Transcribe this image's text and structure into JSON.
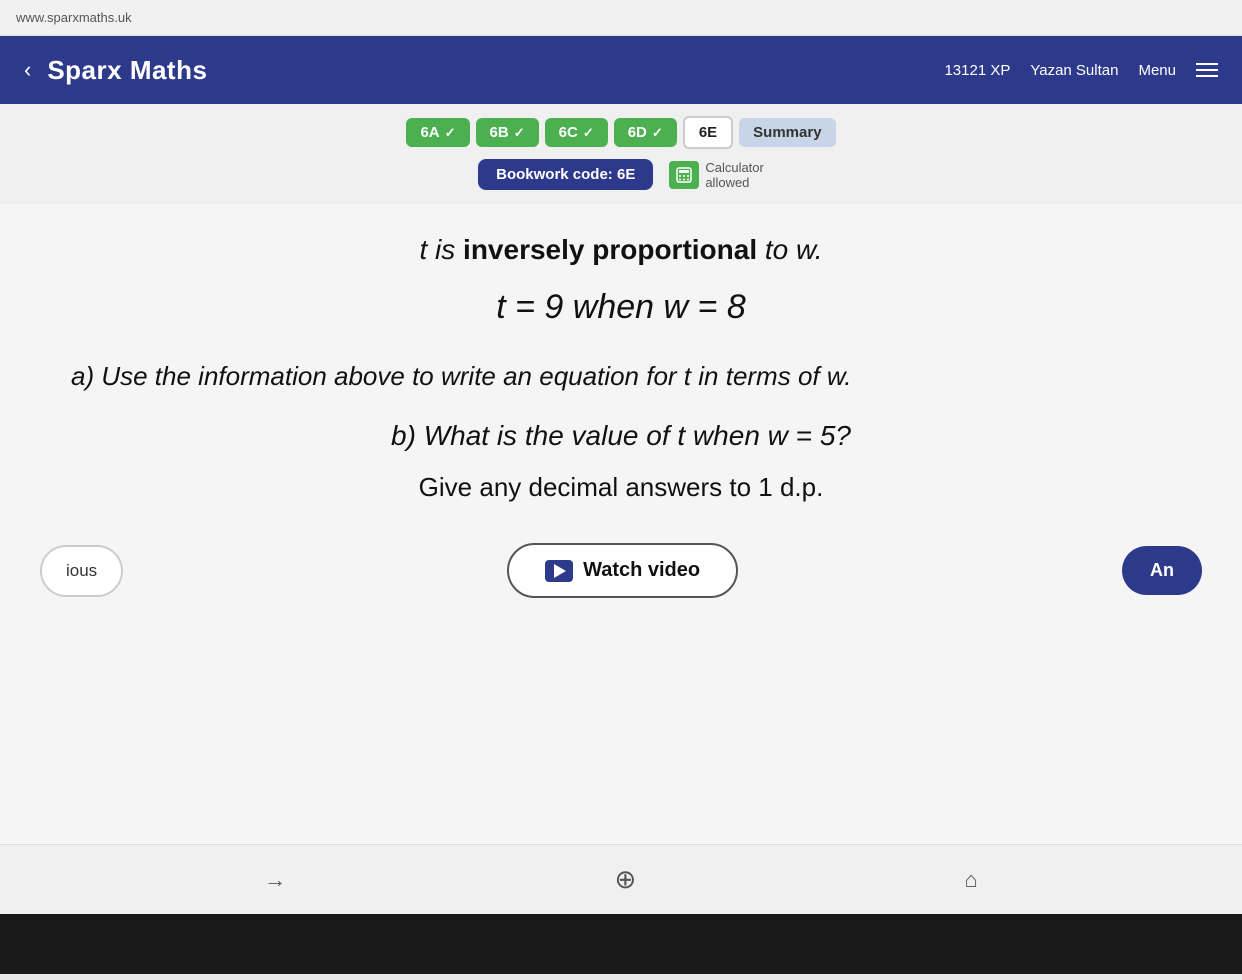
{
  "browser": {
    "url": "www.sparxmaths.uk"
  },
  "header": {
    "title": "Sparx Maths",
    "xp": "13121 XP",
    "user": "Yazan Sultan",
    "menu_label": "Menu"
  },
  "tabs": [
    {
      "id": "6A",
      "label": "6A",
      "state": "completed"
    },
    {
      "id": "6B",
      "label": "6B",
      "state": "completed"
    },
    {
      "id": "6C",
      "label": "6C",
      "state": "completed"
    },
    {
      "id": "6D",
      "label": "6D",
      "state": "completed"
    },
    {
      "id": "6E",
      "label": "6E",
      "state": "active"
    },
    {
      "id": "Summary",
      "label": "Summary",
      "state": "summary"
    }
  ],
  "bookwork": {
    "label": "Bookwork code: 6E",
    "calculator_label": "Calculator",
    "calculator_status": "allowed"
  },
  "question": {
    "intro": "t is inversely proportional to w.",
    "given": "t = 9 when w = 8",
    "part_a": "a) Use the information above to write an equation for t in terms of w.",
    "part_b": "b) What is the value of t when w = 5?",
    "decimal_note": "Give any decimal answers to 1 d.p."
  },
  "buttons": {
    "previous": "ious",
    "watch_video": "Watch video",
    "answer": "An"
  },
  "device_nav": {
    "forward_arrow": "→",
    "refresh": "↻",
    "home": "⌂"
  }
}
